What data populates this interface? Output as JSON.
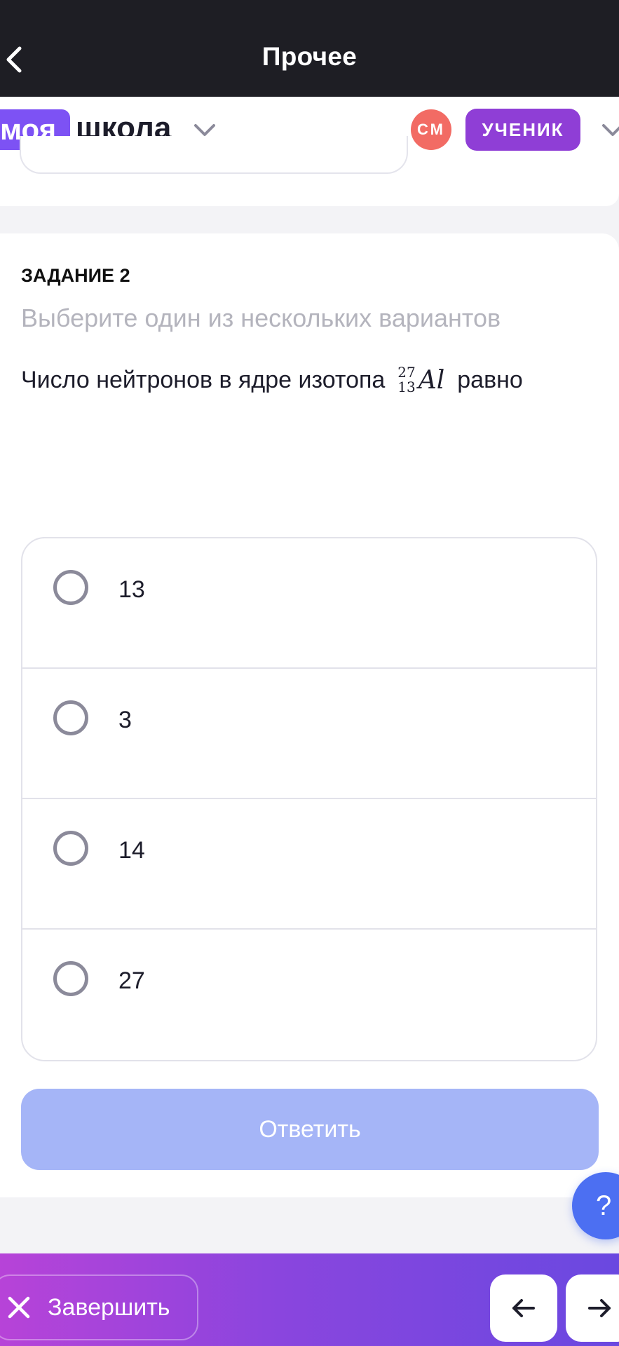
{
  "topbar": {
    "title": "Прочее",
    "back_icon": "chevron-left-icon"
  },
  "school": {
    "logo_part1": "моя",
    "logo_part2": "школа",
    "avatar_initials": "СМ",
    "role": "УЧЕНИК"
  },
  "task": {
    "label": "ЗАДАНИЕ 2",
    "hint": "Выберите один из нескольких вариантов",
    "question_before": "Число нейтронов в ядре изотопа",
    "isotope_mass": "27",
    "isotope_atomic": "13",
    "isotope_symbol": "Al",
    "question_after": "равно",
    "options": [
      {
        "label": "13"
      },
      {
        "label": "3"
      },
      {
        "label": "14"
      },
      {
        "label": "27"
      }
    ],
    "submit_label": "Ответить"
  },
  "help_label": "?",
  "bottom": {
    "finish_label": "Завершить"
  },
  "colors": {
    "topbar": "#1e1e24",
    "brand_violet": "#7d52f4",
    "role_badge": "#8f3ed6",
    "avatar": "#f26b64",
    "submit_disabled": "#a5b5f7",
    "help": "#4c6ff2"
  }
}
